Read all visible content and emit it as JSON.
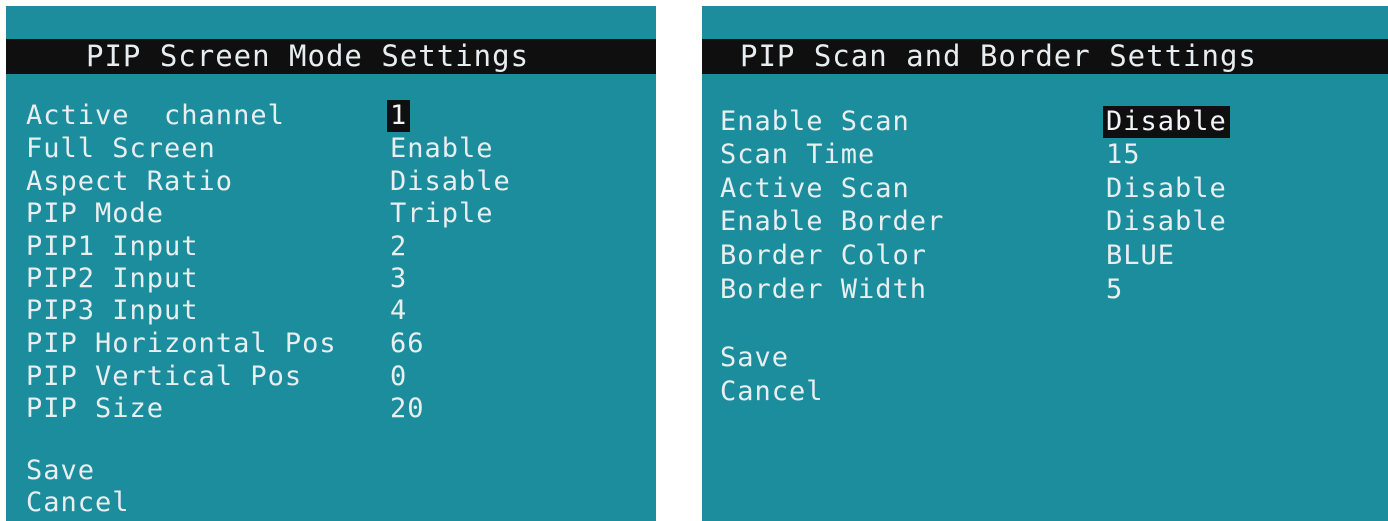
{
  "left": {
    "title": "PIP Screen Mode Settings",
    "rows": [
      {
        "label": "Active  channel",
        "value": "1"
      },
      {
        "label": "Full Screen",
        "value": "Enable"
      },
      {
        "label": "Aspect Ratio",
        "value": "Disable"
      },
      {
        "label": "PIP Mode",
        "value": "Triple"
      },
      {
        "label": "PIP1 Input",
        "value": "2"
      },
      {
        "label": "PIP2 Input",
        "value": "3"
      },
      {
        "label": "PIP3 Input",
        "value": "4"
      },
      {
        "label": "PIP Horizontal Pos",
        "value": "66"
      },
      {
        "label": "PIP Vertical Pos",
        "value": "0"
      },
      {
        "label": "PIP Size",
        "value": "20"
      }
    ],
    "save_label": "Save",
    "cancel_label": "Cancel",
    "selected_row_index": 0
  },
  "right": {
    "title": "PIP Scan and Border Settings",
    "rows": [
      {
        "label": "Enable Scan",
        "value": "Disable"
      },
      {
        "label": "Scan Time",
        "value": "15"
      },
      {
        "label": "Active Scan",
        "value": "Disable"
      },
      {
        "label": "Enable Border",
        "value": "Disable"
      },
      {
        "label": "Border Color",
        "value": "BLUE"
      },
      {
        "label": "Border Width",
        "value": "5"
      }
    ],
    "save_label": "Save",
    "cancel_label": "Cancel",
    "selected_row_index": 0
  },
  "colors": {
    "background": "#1b8d9c",
    "title_bar": "#0f0f10",
    "text": "#e9eef0",
    "highlight": "#0f0f10"
  }
}
